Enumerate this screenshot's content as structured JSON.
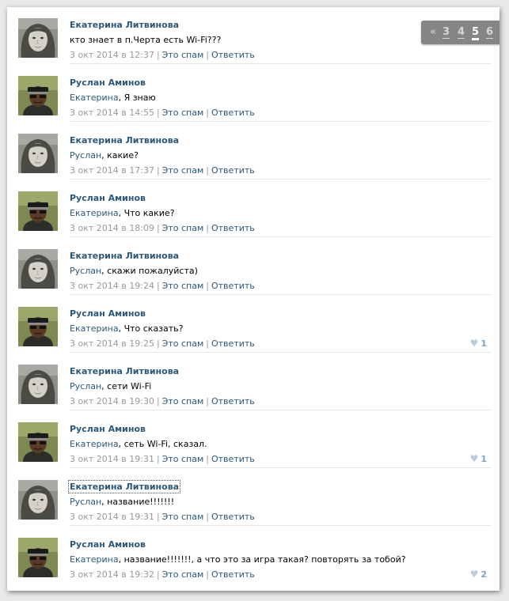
{
  "colors": {
    "link": "#2b587a",
    "meta": "#999999",
    "like": "#7da3c4",
    "pager_bg": "#858585"
  },
  "pager": {
    "prev": "«",
    "pages": [
      "3",
      "4",
      "5",
      "6"
    ],
    "current": "5"
  },
  "comments": [
    {
      "avatar": "female-avatar",
      "author": "Екатерина Литвинова",
      "mention": "",
      "text": "кто знает в п.Черта есть Wi-Fi???",
      "date": "3 окт 2014 в 12:37",
      "spam": "Это спам",
      "reply": "Ответить",
      "likes": ""
    },
    {
      "avatar": "male-avatar",
      "author": "Руслан Аминов",
      "mention": "Екатерина",
      "text": ", Я знаю",
      "date": "3 окт 2014 в 14:55",
      "spam": "Это спам",
      "reply": "Ответить",
      "likes": ""
    },
    {
      "avatar": "female-avatar",
      "author": "Екатерина Литвинова",
      "mention": "Руслан",
      "text": ", какие?",
      "date": "3 окт 2014 в 17:37",
      "spam": "Это спам",
      "reply": "Ответить",
      "likes": ""
    },
    {
      "avatar": "male-avatar",
      "author": "Руслан Аминов",
      "mention": "Екатерина",
      "text": ", Что какие?",
      "date": "3 окт 2014 в 18:09",
      "spam": "Это спам",
      "reply": "Ответить",
      "likes": ""
    },
    {
      "avatar": "female-avatar",
      "author": "Екатерина Литвинова",
      "mention": "Руслан",
      "text": ", скажи пожалуйста)",
      "date": "3 окт 2014 в 19:24",
      "spam": "Это спам",
      "reply": "Ответить",
      "likes": ""
    },
    {
      "avatar": "male-avatar",
      "author": "Руслан Аминов",
      "mention": "Екатерина",
      "text": ", Что сказать?",
      "date": "3 окт 2014 в 19:25",
      "spam": "Это спам",
      "reply": "Ответить",
      "likes": "1"
    },
    {
      "avatar": "female-avatar",
      "author": "Екатерина Литвинова",
      "mention": "Руслан",
      "text": ", сети Wi-Fi",
      "date": "3 окт 2014 в 19:30",
      "spam": "Это спам",
      "reply": "Ответить",
      "likes": ""
    },
    {
      "avatar": "male-avatar",
      "author": "Руслан Аминов",
      "mention": "Екатерина",
      "text": ", сеть Wi-Fi, сказал.",
      "date": "3 окт 2014 в 19:31",
      "spam": "Это спам",
      "reply": "Ответить",
      "likes": "1"
    },
    {
      "avatar": "female-avatar",
      "author": "Екатерина Литвинова",
      "mention": "Руслан",
      "text": ", название!!!!!!!",
      "date": "3 окт 2014 в 19:31",
      "spam": "Это спам",
      "reply": "Ответить",
      "likes": ""
    },
    {
      "avatar": "male-avatar",
      "author": "Руслан Аминов",
      "mention": "Екатерина",
      "text": ", название!!!!!!!, а что это за игра такая? повторять за тобой?",
      "date": "3 окт 2014 в 19:32",
      "spam": "Это спам",
      "reply": "Ответить",
      "likes": "2"
    }
  ]
}
